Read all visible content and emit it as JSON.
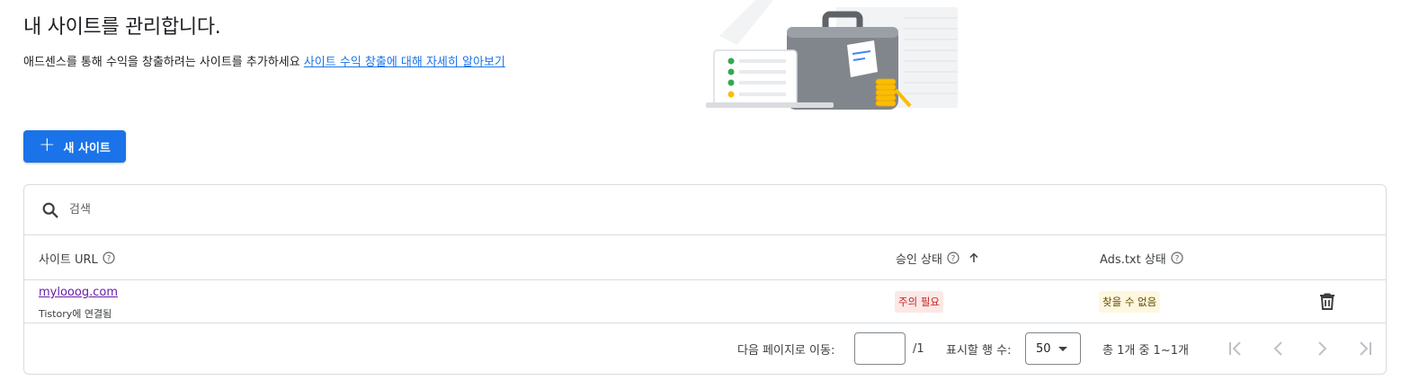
{
  "header": {
    "title": "내 사이트를 관리합니다.",
    "subtitle": "애드센스를 통해 수익을 창출하려는 사이트를 추가하세요",
    "learn_more_link": "사이트 수익 창출에 대해 자세히 알아보기"
  },
  "actions": {
    "new_site_label": "새 사이트"
  },
  "search": {
    "placeholder": "검색"
  },
  "table": {
    "columns": {
      "site_url": "사이트 URL",
      "approval_status": "승인 상태",
      "ads_txt_status": "Ads.txt 상태"
    },
    "rows": [
      {
        "site_url": "mylooog.com",
        "connection": "Tistory에 연결됨",
        "approval_status": "주의 필요",
        "ads_txt_status": "찾을 수 없음"
      }
    ]
  },
  "pagination": {
    "go_to_page_label": "다음 페이지로 이동:",
    "go_to_page_value": "",
    "page_total": "/1",
    "rows_per_page_label": "표시할 행 수:",
    "rows_per_page_value": "50",
    "range_text": "총 1개 중 1~1개"
  },
  "colors": {
    "primary": "#1a73e8",
    "visited_link": "#681da8",
    "warning_bg": "#fce8e6",
    "warning_text": "#c5221f",
    "notfound_bg": "#fef7e0"
  }
}
